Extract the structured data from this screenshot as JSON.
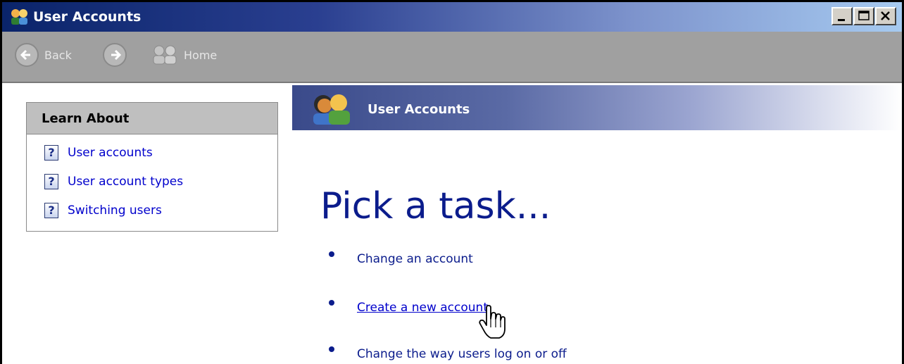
{
  "window": {
    "title": "User Accounts",
    "controls": [
      "minimize",
      "maximize",
      "close"
    ]
  },
  "toolbar": {
    "back_label": "Back",
    "forward_label": "",
    "home_label": "Home"
  },
  "learn_about": {
    "heading": "Learn About",
    "items": [
      {
        "label": "User accounts",
        "icon": "help-icon"
      },
      {
        "label": "User account types",
        "icon": "help-icon"
      },
      {
        "label": "Switching users",
        "icon": "help-icon"
      }
    ]
  },
  "header": {
    "title": "User Accounts",
    "icon": "users-icon"
  },
  "main": {
    "heading": "Pick a task...",
    "tasks": [
      {
        "label": "Change an account"
      },
      {
        "label": "Create a new account"
      },
      {
        "label": "Change the way users log on or off"
      }
    ]
  },
  "colors": {
    "title_bar_start": "#0a246a",
    "title_bar_end": "#a6caf0",
    "link": "#0b1c8c",
    "toolbar": "#a0a0a0"
  }
}
